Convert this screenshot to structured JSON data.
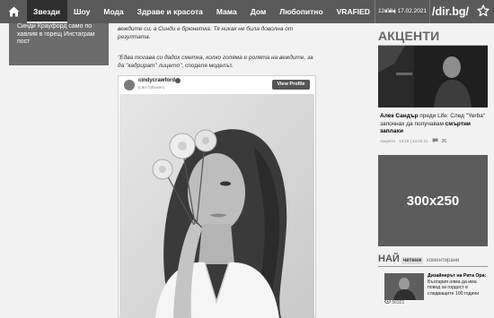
{
  "nav": {
    "items": [
      {
        "label": "Звезди",
        "active": true
      },
      {
        "label": "Шоу"
      },
      {
        "label": "Мода"
      },
      {
        "label": "Здраве и красота"
      },
      {
        "label": "Мама"
      },
      {
        "label": "Дом"
      },
      {
        "label": "Любопитно"
      },
      {
        "label": "VRAFIED"
      }
    ],
    "more": "•••",
    "datetime": "12:08 | 17.02.2021",
    "brand": "/dir.bg/"
  },
  "sidebar": {
    "card_text": "Синди Крауфорд само по хавлия в горещ Инстаграм пост"
  },
  "article": {
    "p1": "веждите си, а Синди е брюнетка. Тя никак не била доволна от резултата.",
    "p2_quote": "\"Едва тогава си дадох сметка, колко голяма е ролята на веждите, за да \"кадрират\" лицето\"",
    "p2_suffix": ", споделя моделът."
  },
  "instagram": {
    "username": "cindycrawford",
    "followers": "6.9m followers",
    "view_profile": "View Profile"
  },
  "accents": {
    "title": "АКЦЕНТИ",
    "headline_name": "Алек Сандър",
    "headline_mid": " преди Life: След \"Yerba\" започнах да получавам ",
    "headline_bold": "смъртни заплахи",
    "meta_section": "Акценти",
    "meta_date": "13:18 | 14.02.21",
    "comments": "26"
  },
  "banner": {
    "label": "300x250"
  },
  "most": {
    "big": "НАЙ",
    "tab1": "четени",
    "tab2": "коментирани",
    "item_name": "Дизайнерът на Рита Ора:",
    "item_text": " България няма да има повод за гордост в следващите 100 години",
    "views": "56321"
  },
  "colors": {
    "topnav": "#5a5a5a",
    "active_tab": "#2e2e2e",
    "banner": "#5c5c5c"
  }
}
